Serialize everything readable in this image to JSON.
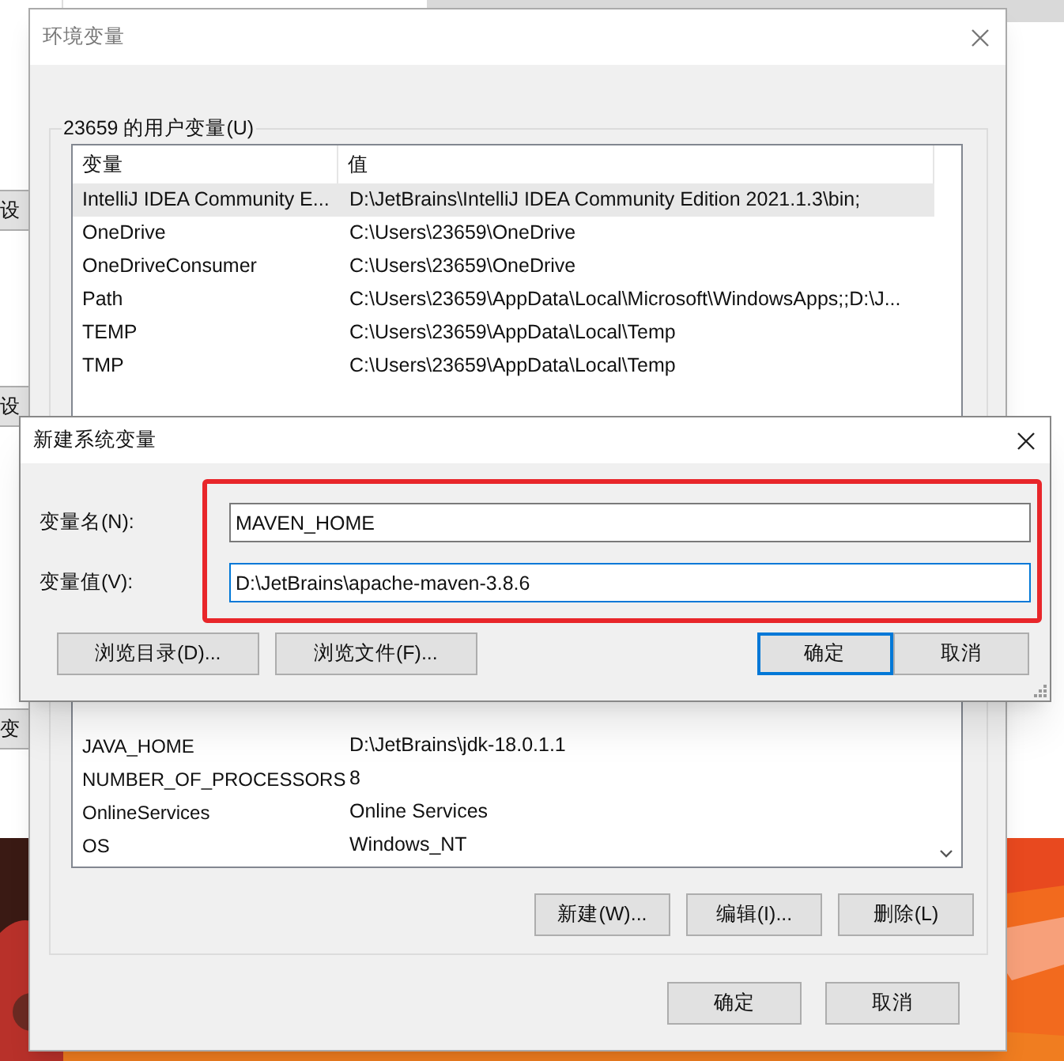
{
  "background_window": {
    "buttons": [
      "设",
      "设",
      "变"
    ]
  },
  "main_dialog": {
    "title": "环境变量",
    "user_group": {
      "label": "23659 的用户变量(U)",
      "columns": [
        "变量",
        "值"
      ],
      "rows": [
        {
          "name": "IntelliJ IDEA Community E...",
          "value": "D:\\JetBrains\\IntelliJ IDEA Community Edition 2021.1.3\\bin;",
          "selected": true
        },
        {
          "name": "OneDrive",
          "value": "C:\\Users\\23659\\OneDrive",
          "selected": false
        },
        {
          "name": "OneDriveConsumer",
          "value": "C:\\Users\\23659\\OneDrive",
          "selected": false
        },
        {
          "name": "Path",
          "value": "C:\\Users\\23659\\AppData\\Local\\Microsoft\\WindowsApps;;D:\\J...",
          "selected": false
        },
        {
          "name": "TEMP",
          "value": "C:\\Users\\23659\\AppData\\Local\\Temp",
          "selected": false
        },
        {
          "name": "TMP",
          "value": "C:\\Users\\23659\\AppData\\Local\\Temp",
          "selected": false
        }
      ]
    },
    "system_group": {
      "rows": [
        {
          "name": "JAVA_HOME",
          "value": "D:\\JetBrains\\jdk-18.0.1.1"
        },
        {
          "name": "NUMBER_OF_PROCESSORS",
          "value": "8"
        },
        {
          "name": "OnlineServices",
          "value": "Online Services"
        },
        {
          "name": "OS",
          "value": "Windows_NT"
        }
      ],
      "buttons": [
        "新建(W)...",
        "编辑(I)...",
        "删除(L)"
      ]
    },
    "buttons": [
      "确定",
      "取消"
    ]
  },
  "new_dialog": {
    "title": "新建系统变量",
    "fields": [
      {
        "label": "变量名(N):",
        "value": "MAVEN_HOME",
        "focused": false
      },
      {
        "label": "变量值(V):",
        "value": "D:\\JetBrains\\apache-maven-3.8.6",
        "focused": true
      }
    ],
    "buttons": [
      {
        "label": "浏览目录(D)...",
        "default": false
      },
      {
        "label": "浏览文件(F)...",
        "default": false
      },
      {
        "label": "确定",
        "default": true
      },
      {
        "label": "取消",
        "default": false
      }
    ]
  }
}
